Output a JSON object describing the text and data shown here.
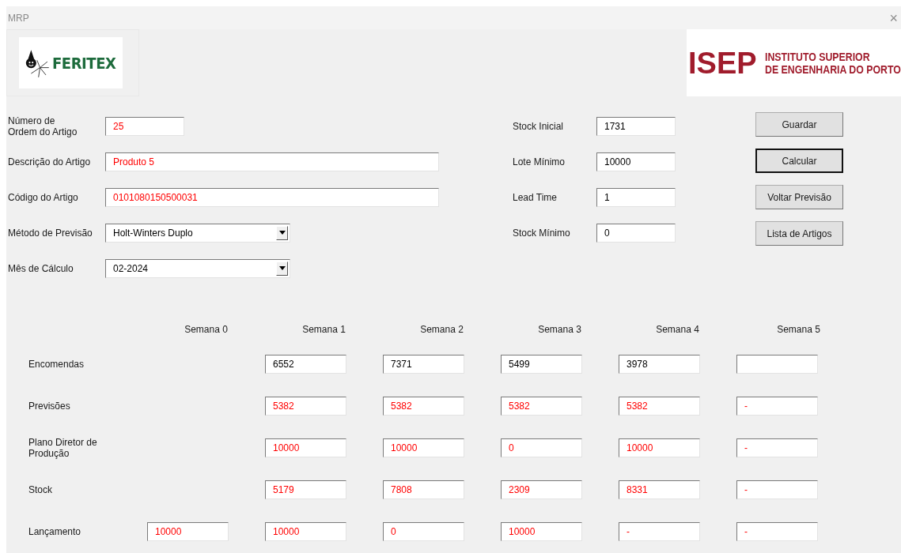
{
  "window": {
    "title": "MRP",
    "close": "×"
  },
  "logos": {
    "left": {
      "text": "FERITEX"
    },
    "right": {
      "mark": "ISEP",
      "line1": "INSTITUTO SUPERIOR",
      "line2": "DE ENGENHARIA DO PORTO"
    }
  },
  "left_fields": [
    {
      "label": "Número de Ordem do Artigo",
      "kind": "text",
      "value": "25",
      "computed": true
    },
    {
      "label": "Descrição do Artigo",
      "kind": "text",
      "value": "Produto 5",
      "computed": true
    },
    {
      "label": "Código do Artigo",
      "kind": "text",
      "value": "0101080150500031",
      "computed": true
    },
    {
      "label": "Método de Previsão",
      "kind": "dropdown",
      "value": "Holt-Winters Duplo",
      "computed": false
    },
    {
      "label": "Mês de Cálculo",
      "kind": "dropdown",
      "value": "02-2024",
      "computed": false
    }
  ],
  "right_fields": [
    {
      "label": "Stock Inicial",
      "value": "1731"
    },
    {
      "label": "Lote Mínimo",
      "value": "10000"
    },
    {
      "label": "Lead Time",
      "value": "1"
    },
    {
      "label": "Stock Mínimo",
      "value": "0"
    }
  ],
  "buttons": [
    {
      "label": "Guardar",
      "focused": false
    },
    {
      "label": "Calcular",
      "focused": true
    },
    {
      "label": "Voltar Previsão",
      "focused": false
    },
    {
      "label": "Lista de Artigos",
      "focused": false
    }
  ],
  "table": {
    "columns": [
      "Semana 0",
      "Semana 1",
      "Semana 2",
      "Semana 3",
      "Semana 4",
      "Semana 5"
    ],
    "rows": [
      {
        "label": "Encomendas",
        "cells": [
          null,
          {
            "value": "6552",
            "computed": false
          },
          {
            "value": "7371",
            "computed": false
          },
          {
            "value": "5499",
            "computed": false
          },
          {
            "value": "3978",
            "computed": false
          },
          {}
        ]
      },
      {
        "label": "Previsões",
        "cells": [
          null,
          {
            "value": "5382",
            "computed": true
          },
          {
            "value": "5382",
            "computed": true
          },
          {
            "value": "5382",
            "computed": true
          },
          {
            "value": "5382",
            "computed": true
          },
          {
            "value": "-",
            "computed": true
          }
        ]
      },
      {
        "label": "Plano Diretor de Produção",
        "cells": [
          null,
          {
            "value": "10000",
            "computed": true
          },
          {
            "value": "10000",
            "computed": true
          },
          {
            "value": "0",
            "computed": true
          },
          {
            "value": "10000",
            "computed": true
          },
          {
            "value": "-",
            "computed": true
          }
        ]
      },
      {
        "label": "Stock",
        "cells": [
          null,
          {
            "value": "5179",
            "computed": true
          },
          {
            "value": "7808",
            "computed": true
          },
          {
            "value": "2309",
            "computed": true
          },
          {
            "value": "8331",
            "computed": true
          },
          {
            "value": "-",
            "computed": true
          }
        ]
      },
      {
        "label": "Lançamento",
        "cells": [
          {
            "value": "10000",
            "computed": true
          },
          {
            "value": "10000",
            "computed": true
          },
          {
            "value": "0",
            "computed": true
          },
          {
            "value": "10000",
            "computed": true
          },
          {
            "value": "-",
            "computed": true
          },
          {
            "value": "-",
            "computed": true
          }
        ]
      }
    ]
  }
}
